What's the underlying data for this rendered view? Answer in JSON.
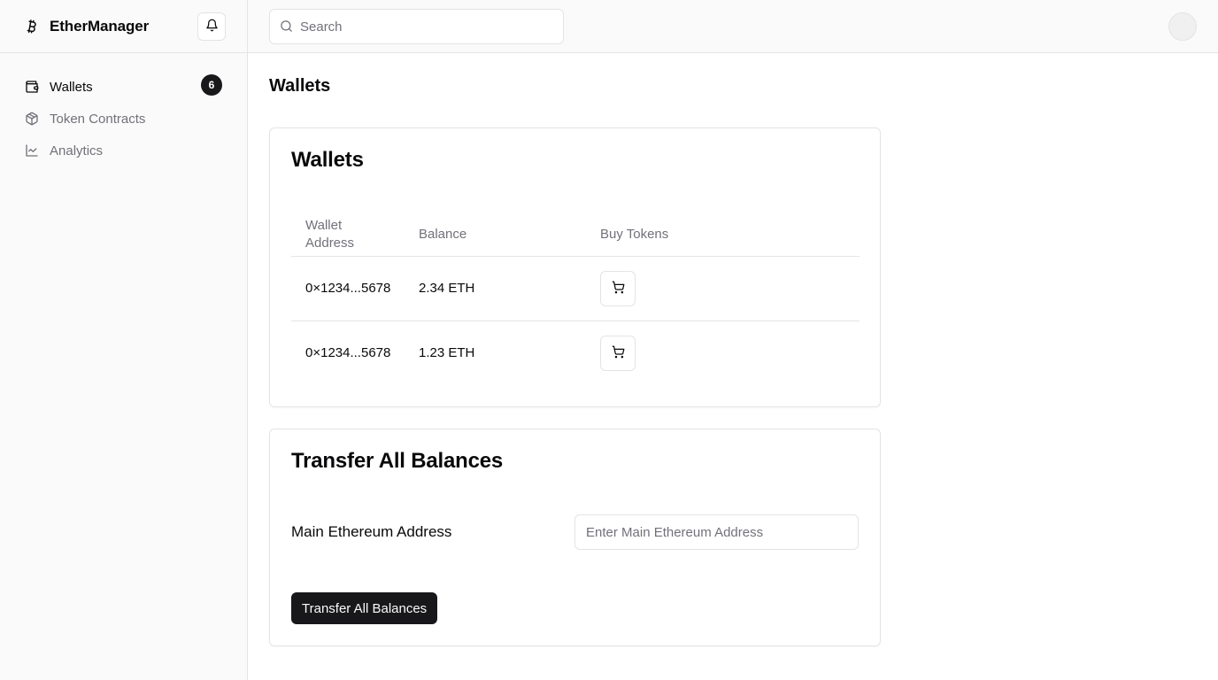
{
  "app": {
    "name": "EtherManager",
    "brand_icon": "bitcoin-icon"
  },
  "header": {
    "notifications_icon": "bell-icon",
    "search": {
      "placeholder": "Search",
      "value": "",
      "icon": "search-icon"
    },
    "avatar": "user-avatar"
  },
  "sidebar": {
    "items": [
      {
        "label": "Wallets",
        "icon": "wallet-icon",
        "active": true,
        "badge": "6"
      },
      {
        "label": "Token Contracts",
        "icon": "package-icon",
        "active": false
      },
      {
        "label": "Analytics",
        "icon": "line-chart-icon",
        "active": false
      }
    ]
  },
  "main": {
    "page_title": "Wallets",
    "wallets_card": {
      "title": "Wallets",
      "columns": [
        "Wallet Address",
        "Balance",
        "Buy Tokens"
      ],
      "rows": [
        {
          "address": "0×1234...5678",
          "balance": "2.34 ETH",
          "action_icon": "shopping-cart-icon"
        },
        {
          "address": "0×1234...5678",
          "balance": "1.23 ETH",
          "action_icon": "shopping-cart-icon"
        }
      ]
    },
    "transfer_card": {
      "title": "Transfer All Balances",
      "field_label": "Main Ethereum Address",
      "field_placeholder": "Enter Main Ethereum Address",
      "field_value": "",
      "button_label": "Transfer All Balances"
    }
  },
  "colors": {
    "primary": "#18181b",
    "border": "#e4e4e7",
    "muted_text": "#71717a",
    "sidebar_bg": "#fafafa"
  }
}
